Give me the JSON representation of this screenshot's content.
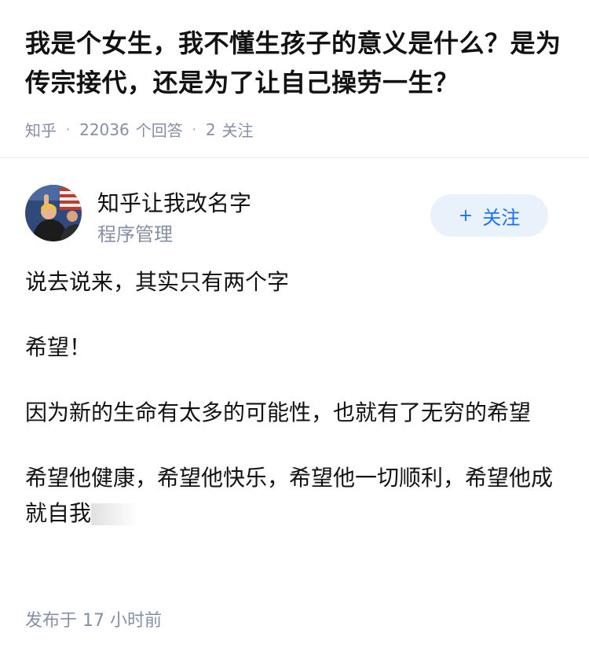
{
  "question": {
    "title": "我是个女生，我不懂生孩子的意义是什么？是为传宗接代，还是为了让自己操劳一生？",
    "source": "知乎",
    "answers_count": "22036",
    "answers_label": "个回答",
    "followers_count": "2",
    "followers_label": "关注",
    "separator": "·"
  },
  "author": {
    "name": "知乎让我改名字",
    "headline": "程序管理",
    "avatar_icon": "avatar-photo-icon",
    "follow_plus": "+",
    "follow_label": "关注"
  },
  "answer": {
    "paragraphs": [
      "说去说来，其实只有两个字",
      "希望！",
      "因为新的生命有太多的可能性，也就有了无穷的希望",
      "希望他健康，希望他快乐，希望他一切顺利，希望他成就自我"
    ],
    "publish_time": "发布于 17 小时前"
  },
  "colors": {
    "text_primary": "#121212",
    "text_secondary": "#8590a6",
    "follow_bg": "#e9f1fa",
    "follow_text": "#1772f6",
    "divider": "#ebebeb"
  }
}
